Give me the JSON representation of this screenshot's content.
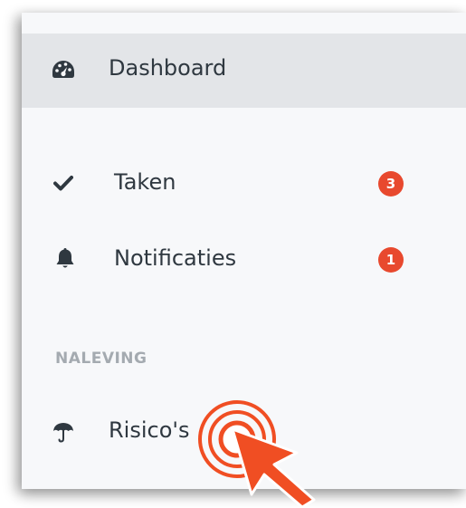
{
  "sidebar": {
    "items": [
      {
        "label": "Dashboard",
        "icon": "dashboard-icon",
        "active": true
      },
      {
        "label": "Taken",
        "icon": "check-icon",
        "badge": "3"
      },
      {
        "label": "Notificaties",
        "icon": "bell-icon",
        "badge": "1"
      }
    ],
    "sections": [
      {
        "header": "NALEVING",
        "items": [
          {
            "label": "Risico's",
            "icon": "umbrella-icon"
          }
        ]
      }
    ]
  },
  "colors": {
    "panel_background": "#f7f8fa",
    "active_item_background": "#e3e5e8",
    "text": "#2f3840",
    "section_header": "#a4aab0",
    "badge": "#e8492e",
    "cursor_accent": "#f04e23"
  }
}
